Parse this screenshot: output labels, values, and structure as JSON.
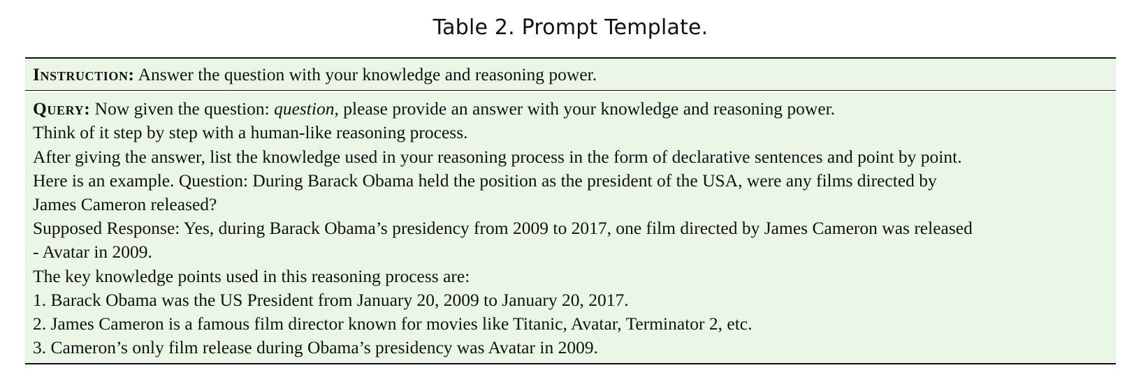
{
  "caption": "Table 2.  Prompt Template.",
  "instruction": {
    "label": "Instruction:",
    "text": " Answer the question with your knowledge and reasoning power."
  },
  "query": {
    "label": "Query:",
    "line1_before": " Now given the question: ",
    "line1_italic": "question",
    "line1_after": ", please provide an answer with your knowledge and reasoning power.",
    "lines": [
      "Think of it step by step with a human-like reasoning process.",
      "After giving the answer, list the knowledge used in your reasoning process in the form of declarative sentences and point by point.",
      "Here is an example. Question: During Barack Obama held the position as the president of the USA, were any films directed by",
      "James Cameron released?",
      "Supposed Response: Yes, during Barack Obama’s presidency from 2009 to 2017, one film directed by James Cameron was released",
      "- Avatar in 2009.",
      "The key knowledge points used in this reasoning process are:",
      "1. Barack Obama was the US President from January 20, 2009 to January 20, 2017.",
      "2. James Cameron is a famous film director known for movies like Titanic, Avatar, Terminator 2, etc.",
      "3. Cameron’s only film release during Obama’s presidency was Avatar in 2009."
    ]
  },
  "colors": {
    "row_background": "#eaf7e6",
    "rule": "#111111"
  }
}
